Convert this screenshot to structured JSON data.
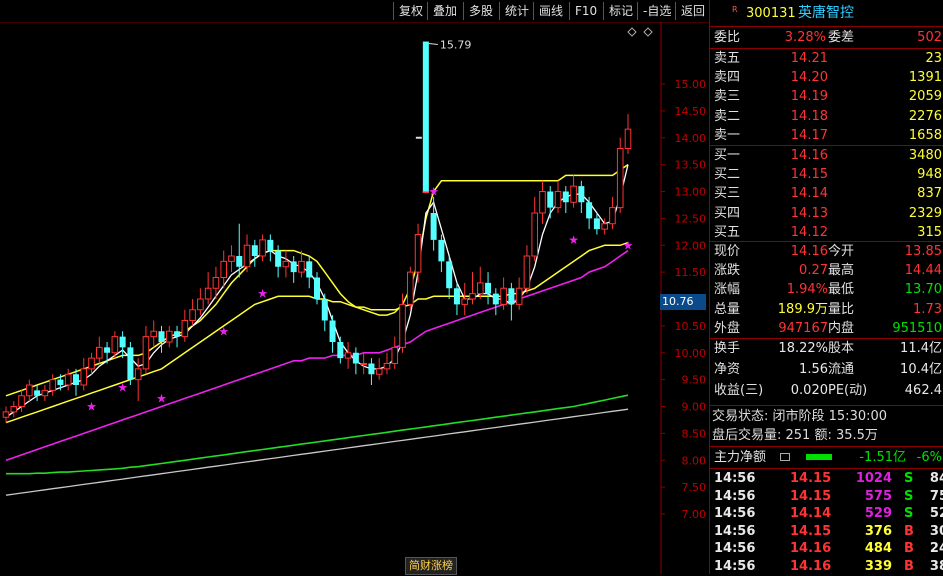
{
  "toolbar": {
    "buttons": [
      "复权",
      "叠加",
      "多股",
      "统计",
      "画线",
      "F10",
      "标记",
      "-自选",
      "返回"
    ]
  },
  "chart": {
    "high_label": "15.79",
    "axis_ticks": [
      "15.00",
      "14.50",
      "14.00",
      "13.50",
      "13.00",
      "12.50",
      "12.00",
      "11.50",
      "11.00",
      "10.50",
      "10.00",
      "9.50",
      "9.00",
      "8.50",
      "8.00",
      "7.50",
      "7.00"
    ],
    "current_price_tag": "10.76",
    "footer_tag": "简财涨榜"
  },
  "chart_data": {
    "type": "candlestick",
    "y_range": [
      6.6,
      15.9
    ],
    "candles": [
      [
        8.8,
        8.9,
        8.7,
        9.0
      ],
      [
        8.9,
        9.0,
        8.8,
        9.1
      ],
      [
        9.0,
        9.2,
        8.9,
        9.3
      ],
      [
        9.2,
        9.4,
        9.1,
        9.5
      ],
      [
        9.3,
        9.2,
        9.1,
        9.4
      ],
      [
        9.2,
        9.3,
        9.1,
        9.4
      ],
      [
        9.3,
        9.5,
        9.2,
        9.6
      ],
      [
        9.5,
        9.4,
        9.3,
        9.6
      ],
      [
        9.4,
        9.6,
        9.3,
        9.7
      ],
      [
        9.6,
        9.4,
        9.2,
        9.7
      ],
      [
        9.4,
        9.7,
        9.3,
        9.9
      ],
      [
        9.7,
        9.9,
        9.6,
        10.0
      ],
      [
        9.9,
        10.1,
        9.8,
        10.3
      ],
      [
        10.1,
        10.0,
        9.8,
        10.2
      ],
      [
        10.0,
        10.3,
        9.9,
        10.4
      ],
      [
        10.3,
        10.1,
        9.9,
        10.4
      ],
      [
        10.1,
        9.5,
        9.4,
        10.2
      ],
      [
        9.5,
        9.7,
        9.1,
        9.9
      ],
      [
        9.7,
        10.3,
        9.6,
        10.5
      ],
      [
        10.3,
        10.4,
        10.1,
        10.6
      ],
      [
        10.4,
        10.2,
        10.0,
        10.5
      ],
      [
        10.2,
        10.4,
        10.1,
        10.5
      ],
      [
        10.4,
        10.3,
        10.1,
        10.5
      ],
      [
        10.3,
        10.6,
        10.2,
        10.8
      ],
      [
        10.6,
        10.8,
        10.5,
        11.0
      ],
      [
        10.8,
        11.0,
        10.7,
        11.2
      ],
      [
        11.0,
        11.2,
        10.9,
        11.5
      ],
      [
        11.2,
        11.4,
        11.0,
        11.6
      ],
      [
        11.4,
        11.7,
        11.2,
        11.9
      ],
      [
        11.7,
        11.8,
        11.5,
        12.0
      ],
      [
        11.8,
        11.6,
        11.4,
        12.4
      ],
      [
        11.6,
        12.0,
        11.5,
        12.2
      ],
      [
        12.0,
        11.8,
        11.6,
        12.1
      ],
      [
        11.8,
        12.1,
        11.7,
        12.2
      ],
      [
        12.1,
        11.9,
        11.7,
        12.2
      ],
      [
        11.9,
        11.6,
        11.4,
        12.0
      ],
      [
        11.6,
        11.7,
        11.4,
        11.9
      ],
      [
        11.7,
        11.5,
        11.3,
        11.8
      ],
      [
        11.5,
        11.7,
        11.4,
        11.9
      ],
      [
        11.7,
        11.4,
        11.2,
        11.8
      ],
      [
        11.4,
        11.0,
        10.9,
        11.5
      ],
      [
        11.0,
        10.6,
        10.4,
        11.1
      ],
      [
        10.6,
        10.2,
        10.0,
        10.7
      ],
      [
        10.2,
        9.9,
        9.8,
        10.3
      ],
      [
        9.9,
        10.0,
        9.7,
        10.2
      ],
      [
        10.0,
        9.8,
        9.6,
        10.1
      ],
      [
        9.8,
        9.8,
        9.6,
        10.0
      ],
      [
        9.8,
        9.6,
        9.4,
        9.9
      ],
      [
        9.6,
        9.7,
        9.5,
        9.9
      ],
      [
        9.7,
        9.8,
        9.6,
        10.0
      ],
      [
        9.8,
        10.1,
        9.7,
        10.3
      ],
      [
        10.1,
        10.9,
        10.0,
        11.1
      ],
      [
        10.9,
        11.5,
        10.8,
        11.6
      ],
      [
        11.5,
        12.2,
        11.3,
        12.4
      ],
      [
        13.0,
        13.0,
        13.0,
        15.79
      ],
      [
        12.6,
        12.1,
        11.9,
        12.9
      ],
      [
        12.1,
        11.7,
        11.5,
        12.2
      ],
      [
        11.7,
        11.2,
        11.0,
        11.8
      ],
      [
        11.2,
        10.9,
        10.7,
        11.3
      ],
      [
        10.9,
        11.0,
        10.7,
        11.3
      ],
      [
        11.0,
        11.1,
        10.9,
        11.5
      ],
      [
        11.1,
        11.3,
        11.0,
        11.6
      ],
      [
        11.3,
        11.1,
        10.9,
        11.5
      ],
      [
        11.1,
        10.9,
        10.7,
        11.2
      ],
      [
        10.9,
        11.2,
        10.8,
        11.4
      ],
      [
        11.2,
        10.9,
        10.6,
        11.3
      ],
      [
        10.9,
        11.2,
        10.8,
        11.4
      ],
      [
        11.2,
        11.8,
        11.1,
        12.0
      ],
      [
        11.8,
        12.6,
        11.7,
        12.9
      ],
      [
        12.6,
        13.0,
        12.4,
        13.2
      ],
      [
        13.0,
        12.7,
        12.5,
        13.1
      ],
      [
        12.7,
        13.0,
        12.6,
        13.2
      ],
      [
        13.0,
        12.8,
        12.6,
        13.1
      ],
      [
        12.8,
        13.1,
        12.7,
        13.3
      ],
      [
        13.1,
        12.8,
        12.6,
        13.2
      ],
      [
        12.8,
        12.5,
        12.3,
        12.9
      ],
      [
        12.5,
        12.3,
        12.2,
        12.6
      ],
      [
        12.3,
        12.4,
        12.2,
        12.5
      ],
      [
        12.4,
        12.7,
        12.3,
        12.9
      ],
      [
        12.7,
        13.8,
        12.6,
        14.0
      ],
      [
        13.8,
        14.16,
        13.7,
        14.44
      ]
    ],
    "ma_short_white": [
      8.8,
      8.9,
      9.0,
      9.1,
      9.2,
      9.25,
      9.3,
      9.35,
      9.4,
      9.45,
      9.5,
      9.6,
      9.75,
      9.85,
      9.95,
      10.05,
      9.9,
      9.75,
      9.8,
      10.0,
      10.15,
      10.25,
      10.3,
      10.35,
      10.5,
      10.65,
      10.85,
      11.05,
      11.25,
      11.45,
      11.55,
      11.65,
      11.75,
      11.85,
      11.9,
      11.8,
      11.75,
      11.65,
      11.6,
      11.5,
      11.3,
      11.0,
      10.6,
      10.2,
      10.0,
      9.85,
      9.75,
      9.7,
      9.7,
      9.75,
      9.9,
      10.2,
      10.7,
      11.5,
      12.6,
      12.8,
      12.3,
      11.8,
      11.3,
      11.0,
      11.0,
      11.1,
      11.1,
      11.0,
      11.0,
      10.9,
      11.0,
      11.2,
      11.6,
      12.2,
      12.6,
      12.8,
      12.9,
      12.95,
      12.95,
      12.8,
      12.6,
      12.4,
      12.45,
      12.9,
      13.5
    ],
    "ma_mid_yellow": [
      9.2,
      9.25,
      9.3,
      9.35,
      9.4,
      9.45,
      9.5,
      9.55,
      9.6,
      9.65,
      9.7,
      9.75,
      9.8,
      9.85,
      9.9,
      9.95,
      9.95,
      9.95,
      10.0,
      10.1,
      10.2,
      10.3,
      10.35,
      10.4,
      10.5,
      10.6,
      10.75,
      10.9,
      11.1,
      11.3,
      11.45,
      11.6,
      11.75,
      11.85,
      11.9,
      11.9,
      11.9,
      11.9,
      11.85,
      11.8,
      11.7,
      11.5,
      11.3,
      11.1,
      10.95,
      10.85,
      10.8,
      10.75,
      10.7,
      10.7,
      10.75,
      10.9,
      11.2,
      11.7,
      12.5,
      13.0,
      13.2,
      13.2,
      13.2,
      13.2,
      13.2,
      13.2,
      13.2,
      13.2,
      13.2,
      13.2,
      13.2,
      13.2,
      13.2,
      13.2,
      13.2,
      13.2,
      13.3,
      13.3,
      13.3,
      13.3,
      13.3,
      13.3,
      13.3,
      13.4,
      13.5
    ],
    "ma_long_yellow": [
      8.7,
      8.75,
      8.8,
      8.85,
      8.9,
      8.95,
      9.0,
      9.05,
      9.1,
      9.15,
      9.2,
      9.25,
      9.3,
      9.35,
      9.4,
      9.45,
      9.5,
      9.55,
      9.6,
      9.65,
      9.7,
      9.8,
      9.9,
      10.0,
      10.1,
      10.2,
      10.3,
      10.4,
      10.5,
      10.6,
      10.7,
      10.8,
      10.9,
      10.95,
      11.0,
      11.05,
      11.05,
      11.05,
      11.05,
      11.05,
      11.0,
      11.0,
      10.95,
      10.95,
      10.9,
      10.85,
      10.85,
      10.8,
      10.8,
      10.8,
      10.8,
      10.85,
      10.9,
      11.0,
      11.0,
      11.05,
      11.05,
      11.05,
      11.05,
      11.05,
      11.05,
      11.05,
      11.05,
      11.05,
      11.05,
      11.1,
      11.1,
      11.15,
      11.2,
      11.3,
      11.4,
      11.5,
      11.6,
      11.7,
      11.8,
      11.9,
      11.95,
      12.0,
      12.0,
      12.0,
      12.05
    ],
    "ma_magenta": [
      8.0,
      8.05,
      8.1,
      8.15,
      8.2,
      8.25,
      8.3,
      8.35,
      8.4,
      8.45,
      8.5,
      8.55,
      8.6,
      8.65,
      8.7,
      8.75,
      8.8,
      8.85,
      8.9,
      8.95,
      9.0,
      9.05,
      9.1,
      9.15,
      9.2,
      9.25,
      9.3,
      9.35,
      9.4,
      9.45,
      9.5,
      9.55,
      9.6,
      9.65,
      9.7,
      9.75,
      9.8,
      9.85,
      9.85,
      9.9,
      9.9,
      9.9,
      9.95,
      9.95,
      9.95,
      9.95,
      10.0,
      10.0,
      10.0,
      10.05,
      10.1,
      10.15,
      10.2,
      10.3,
      10.4,
      10.45,
      10.5,
      10.55,
      10.6,
      10.65,
      10.7,
      10.75,
      10.8,
      10.85,
      10.9,
      10.95,
      11.0,
      11.05,
      11.1,
      11.15,
      11.2,
      11.25,
      11.3,
      11.35,
      11.4,
      11.5,
      11.55,
      11.6,
      11.7,
      11.8,
      11.9
    ],
    "ma_green": [
      7.75,
      7.75,
      7.75,
      7.75,
      7.76,
      7.76,
      7.77,
      7.78,
      7.78,
      7.79,
      7.8,
      7.81,
      7.82,
      7.83,
      7.84,
      7.85,
      7.87,
      7.88,
      7.9,
      7.92,
      7.94,
      7.96,
      7.98,
      8.0,
      8.02,
      8.04,
      8.06,
      8.08,
      8.1,
      8.12,
      8.14,
      8.16,
      8.18,
      8.2,
      8.22,
      8.24,
      8.26,
      8.28,
      8.3,
      8.32,
      8.34,
      8.36,
      8.38,
      8.4,
      8.42,
      8.44,
      8.46,
      8.48,
      8.5,
      8.52,
      8.54,
      8.56,
      8.58,
      8.6,
      8.62,
      8.64,
      8.66,
      8.68,
      8.7,
      8.72,
      8.74,
      8.76,
      8.78,
      8.8,
      8.82,
      8.84,
      8.86,
      8.88,
      8.9,
      8.92,
      8.94,
      8.96,
      8.98,
      9.0,
      9.03,
      9.06,
      9.09,
      9.12,
      9.15,
      9.18,
      9.21
    ],
    "ma_gray": [
      7.35,
      7.37,
      7.39,
      7.41,
      7.43,
      7.45,
      7.47,
      7.49,
      7.51,
      7.53,
      7.55,
      7.57,
      7.59,
      7.61,
      7.63,
      7.65,
      7.67,
      7.69,
      7.71,
      7.73,
      7.75,
      7.77,
      7.79,
      7.81,
      7.83,
      7.85,
      7.87,
      7.89,
      7.91,
      7.93,
      7.95,
      7.97,
      7.99,
      8.01,
      8.03,
      8.05,
      8.07,
      8.09,
      8.11,
      8.13,
      8.15,
      8.17,
      8.19,
      8.21,
      8.23,
      8.25,
      8.27,
      8.29,
      8.31,
      8.33,
      8.35,
      8.37,
      8.39,
      8.41,
      8.43,
      8.45,
      8.47,
      8.49,
      8.51,
      8.53,
      8.55,
      8.57,
      8.59,
      8.61,
      8.63,
      8.65,
      8.67,
      8.69,
      8.71,
      8.73,
      8.75,
      8.77,
      8.79,
      8.81,
      8.83,
      8.85,
      8.87,
      8.89,
      8.91,
      8.93,
      8.95
    ],
    "star_markers": [
      [
        11,
        9.0
      ],
      [
        15,
        9.35
      ],
      [
        20,
        9.15
      ],
      [
        28,
        10.4
      ],
      [
        33,
        11.1
      ],
      [
        55,
        13.0
      ],
      [
        80,
        12.0
      ],
      [
        73,
        12.1
      ]
    ]
  },
  "quote": {
    "code": "300131",
    "name": "英唐智控",
    "flag": "R",
    "webi_label": "委比",
    "webi_value": "3.28%",
    "weicha_label": "委差",
    "weicha_value": "502",
    "sells": [
      {
        "label": "卖五",
        "price": "14.21",
        "vol": "23"
      },
      {
        "label": "卖四",
        "price": "14.20",
        "vol": "1391"
      },
      {
        "label": "卖三",
        "price": "14.19",
        "vol": "2059"
      },
      {
        "label": "卖二",
        "price": "14.18",
        "vol": "2276"
      },
      {
        "label": "卖一",
        "price": "14.17",
        "vol": "1658"
      }
    ],
    "buys": [
      {
        "label": "买一",
        "price": "14.16",
        "vol": "3480"
      },
      {
        "label": "买二",
        "price": "14.15",
        "vol": "948"
      },
      {
        "label": "买三",
        "price": "14.14",
        "vol": "837"
      },
      {
        "label": "买四",
        "price": "14.13",
        "vol": "2329"
      },
      {
        "label": "买五",
        "price": "14.12",
        "vol": "315"
      }
    ],
    "stats": [
      {
        "l1": "现价",
        "v1": "14.16",
        "l2": "今开",
        "v2": "13.85"
      },
      {
        "l1": "涨跌",
        "v1": "0.27",
        "l2": "最高",
        "v2": "14.44"
      },
      {
        "l1": "涨幅",
        "v1": "1.94%",
        "l2": "最低",
        "v2": "13.70"
      },
      {
        "l1": "总量",
        "v1": "189.9万",
        "l2": "量比",
        "v2": "1.73"
      },
      {
        "l1": "外盘",
        "v1": "947167",
        "l2": "内盘",
        "v2": "951510"
      }
    ],
    "fund": [
      {
        "l1": "换手",
        "v1": "18.22%",
        "l2": "股本",
        "v2": "11.4亿"
      },
      {
        "l1": "净资",
        "v1": "1.56",
        "l2": "流通",
        "v2": "10.4亿"
      },
      {
        "l1": "收益(三)",
        "v1": "0.020",
        "l2": "PE(动)",
        "v2": "462.4"
      }
    ],
    "trade_state": "交易状态: 闭市阶段 15:30:00",
    "after_hours": "盘后交易量: 251  额: 35.5万",
    "main_fund_label": "主力净额",
    "main_fund_value": "-1.51亿",
    "main_fund_pct": "-6%",
    "ticks": [
      {
        "t": "14:56",
        "p": "14.15",
        "v": "1024",
        "d": "S",
        "n": "84"
      },
      {
        "t": "14:56",
        "p": "14.15",
        "v": "575",
        "d": "S",
        "n": "75"
      },
      {
        "t": "14:56",
        "p": "14.14",
        "v": "529",
        "d": "S",
        "n": "52"
      },
      {
        "t": "14:56",
        "p": "14.15",
        "v": "376",
        "d": "B",
        "n": "30"
      },
      {
        "t": "14:56",
        "p": "14.16",
        "v": "484",
        "d": "B",
        "n": "24"
      },
      {
        "t": "14:56",
        "p": "14.16",
        "v": "339",
        "d": "B",
        "n": "38"
      }
    ]
  }
}
